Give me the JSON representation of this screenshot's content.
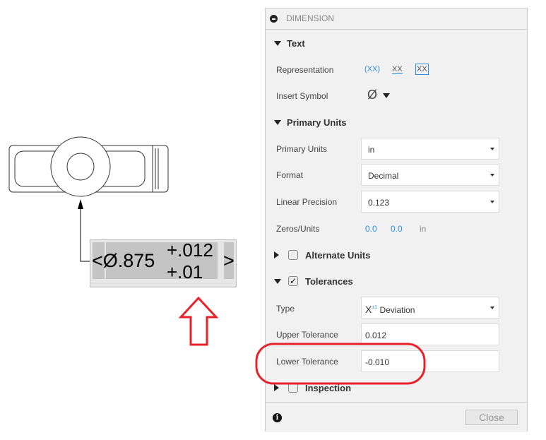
{
  "drawing": {
    "dimension_text": "<Ø.875",
    "upper": "+.012",
    "lower": "+.01",
    "close_bracket": ">"
  },
  "panel": {
    "title": "DIMENSION",
    "text_section": "Text",
    "representation_label": "Representation",
    "rep_options": [
      "(XX)",
      "XX",
      "XX"
    ],
    "insert_symbol_label": "Insert Symbol",
    "insert_symbol_value": "Ø",
    "primary_units_section": "Primary Units",
    "primary_units_label": "Primary Units",
    "primary_units_value": "in",
    "format_label": "Format",
    "format_value": "Decimal",
    "linear_precision_label": "Linear Precision",
    "linear_precision_value": "0.123",
    "zeros_label": "Zeros/Units",
    "zeros_values": [
      "0.0",
      "0.0",
      "in"
    ],
    "alternate_units_section": "Alternate Units",
    "tolerances_section": "Tolerances",
    "type_label": "Type",
    "type_value": "Deviation",
    "type_icon_text": "X",
    "upper_label": "Upper Tolerance",
    "upper_value": "0.012",
    "lower_label": "Lower Tolerance",
    "lower_value": "-0.010",
    "inspection_section": "Inspection",
    "close_label": "Close"
  },
  "colors": {
    "accent": "#2a8fd8",
    "highlight": "#e8222a"
  }
}
